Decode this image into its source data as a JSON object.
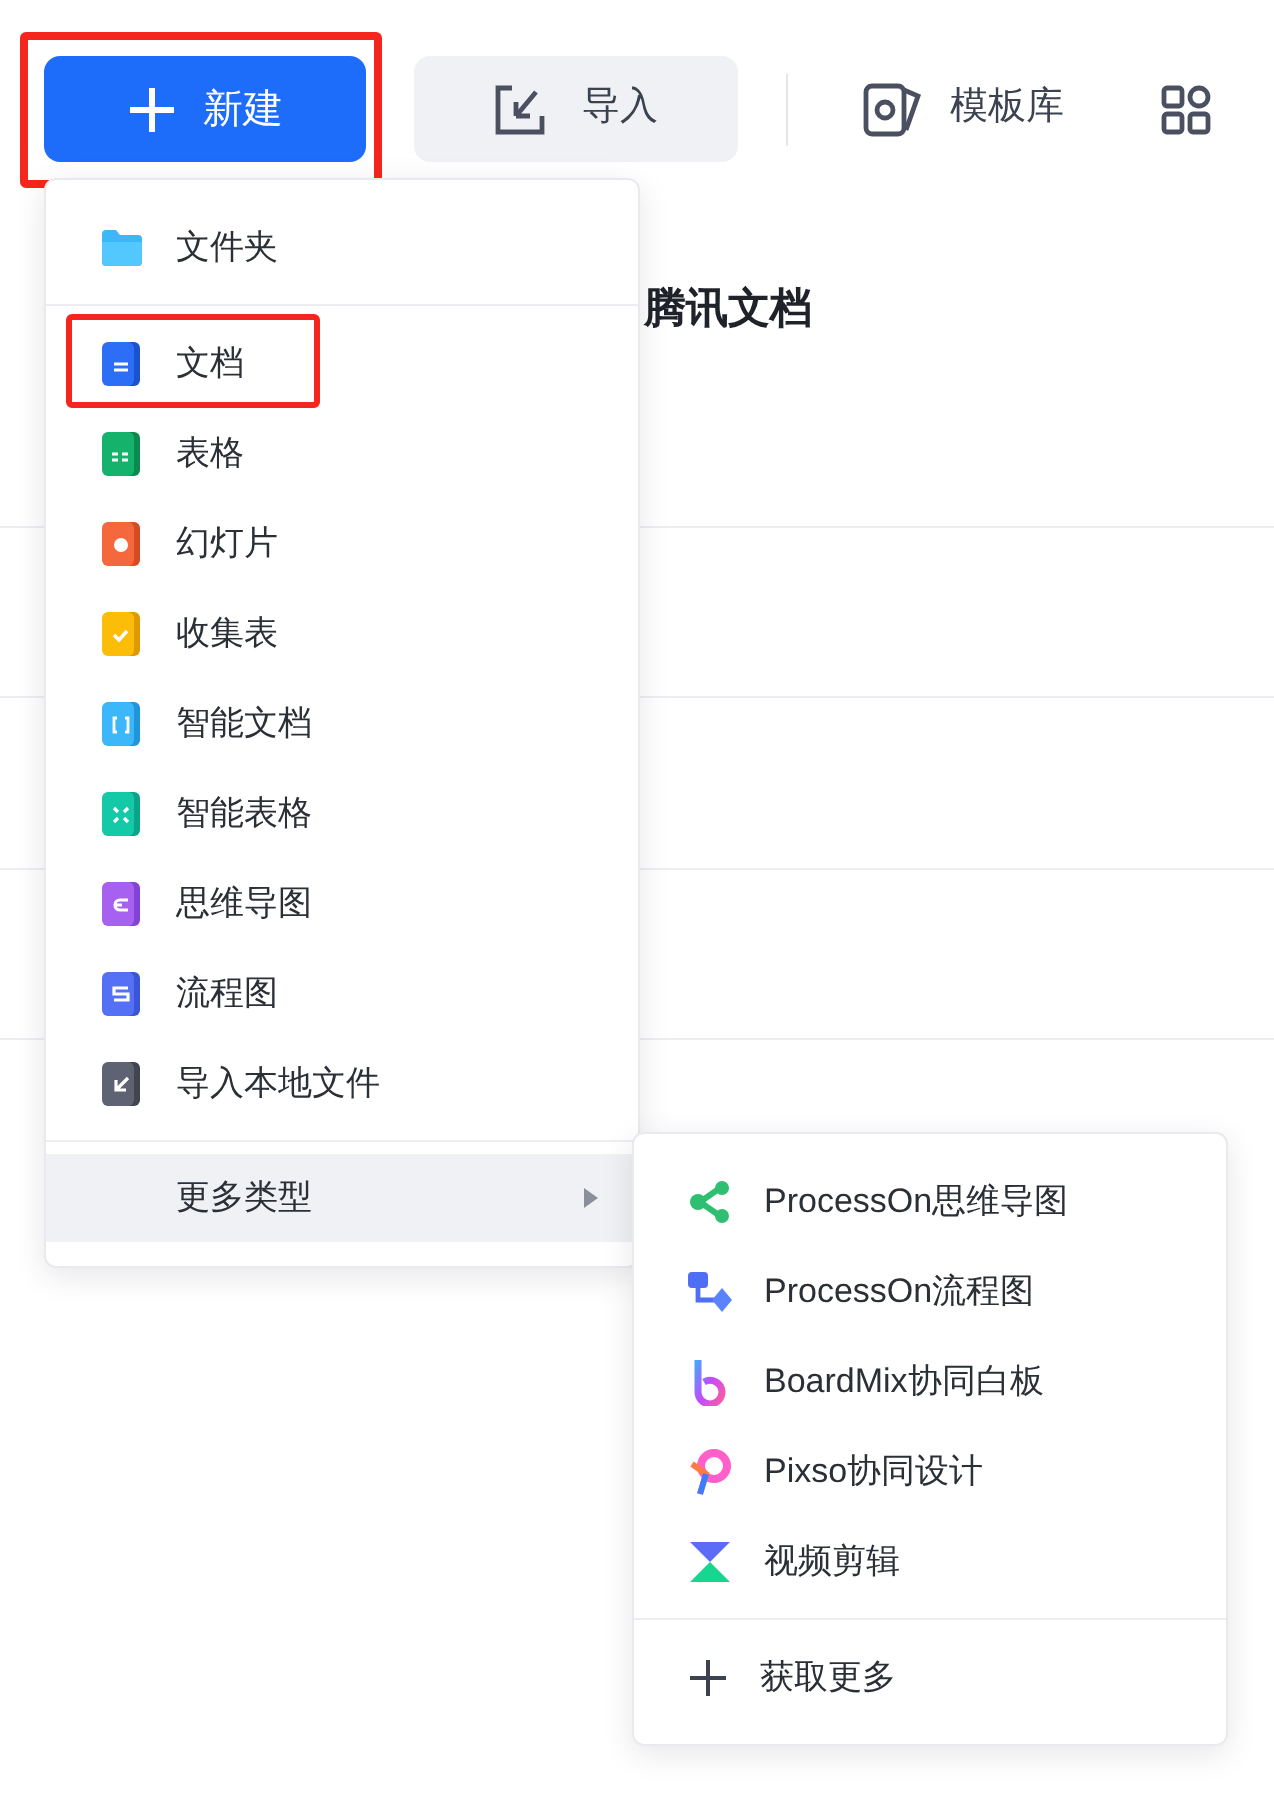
{
  "toolbar": {
    "new_button": {
      "label": "新建",
      "highlighted": true
    },
    "import_button": {
      "label": "导入"
    },
    "template_button": {
      "label": "模板库"
    }
  },
  "content": {
    "heading": "腾讯文档"
  },
  "new_menu": {
    "items": [
      {
        "kind": "folder",
        "label": "文件夹",
        "highlighted": false
      },
      {
        "kind": "doc",
        "label": "文档",
        "highlighted": true
      },
      {
        "kind": "sheet",
        "label": "表格",
        "highlighted": false
      },
      {
        "kind": "slide",
        "label": "幻灯片",
        "highlighted": false
      },
      {
        "kind": "form",
        "label": "收集表",
        "highlighted": false
      },
      {
        "kind": "smartdoc",
        "label": "智能文档",
        "highlighted": false
      },
      {
        "kind": "smartsheet",
        "label": "智能表格",
        "highlighted": false
      },
      {
        "kind": "mindmap",
        "label": "思维导图",
        "highlighted": false
      },
      {
        "kind": "flowchart",
        "label": "流程图",
        "highlighted": false
      },
      {
        "kind": "import",
        "label": "导入本地文件",
        "highlighted": false
      }
    ],
    "more": {
      "label": "更多类型",
      "selected": true
    }
  },
  "more_menu": {
    "items": [
      {
        "kind": "mindmap",
        "label": "ProcessOn思维导图"
      },
      {
        "kind": "flowchart",
        "label": "ProcessOn流程图"
      },
      {
        "kind": "whiteboard",
        "label": "BoardMix协同白板"
      },
      {
        "kind": "design",
        "label": "Pixso协同设计"
      },
      {
        "kind": "video",
        "label": "视频剪辑"
      }
    ],
    "footer": {
      "label": "获取更多"
    }
  }
}
